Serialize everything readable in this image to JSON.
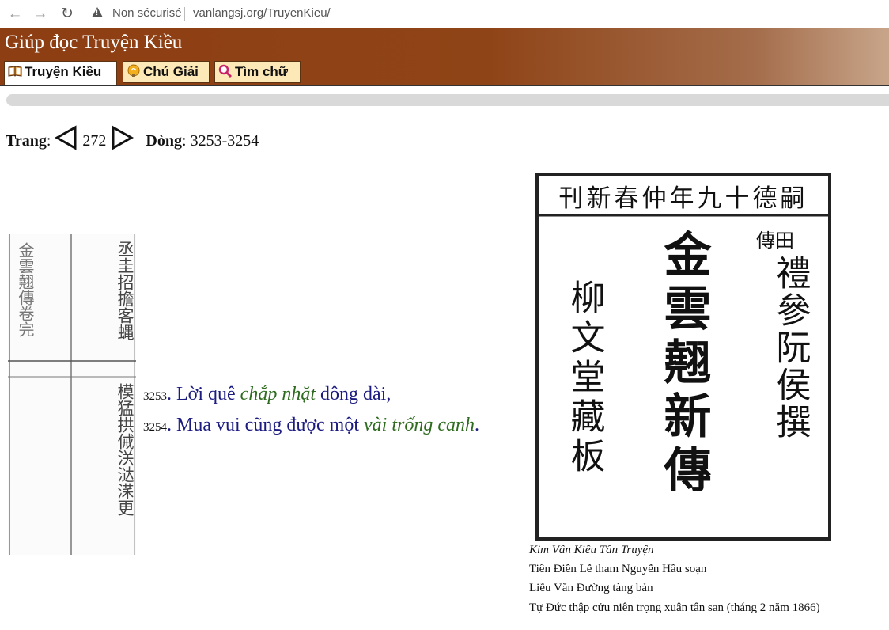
{
  "browser": {
    "security_label": "Non sécurisé",
    "url": "vanlangsj.org/TruyenKieu/"
  },
  "site": {
    "title": "Giúp đọc Truyện Kiều",
    "tabs": [
      {
        "label": "Truyện Kiều",
        "icon": "book-icon",
        "active": true
      },
      {
        "label": "Chú Giải",
        "icon": "lightbulb-icon",
        "active": false
      },
      {
        "label": "Tìm chữ",
        "icon": "magnifier-icon",
        "active": false
      }
    ],
    "colors": {
      "header_brown": "#8d3e12",
      "tab_bg": "#fde8b7",
      "verse_blue": "#1c1c80",
      "verse_green": "#2e6b1f"
    }
  },
  "pager": {
    "page_label": "Trang",
    "page_number": "272",
    "line_label": "Dòng",
    "line_range": "3253-3254"
  },
  "verses": [
    {
      "num": "3253",
      "before": "Lời quê ",
      "italic": "chắp nhặt",
      "after": " dông dài,"
    },
    {
      "num": "3254",
      "before": "Mua vui cũng được một ",
      "italic": "vài trống canh",
      "after": "."
    }
  ],
  "cover": {
    "header_text": "刊新春仲年九十德嗣",
    "center_column": "金雲翹新傳",
    "right_small": "傳田",
    "right_column": "禮參阮侯撰",
    "left_column": "柳文堂藏板"
  },
  "manuscript": {
    "col1": "金雲翹傳卷完",
    "col2": "丞圭招擔客蝿",
    "col3": "模猛拱㑘浂㳠㴕更"
  },
  "caption": {
    "title": "Kim Vân Kiều Tân Truyện",
    "line2": "Tiên Điền Lễ tham Nguyễn Hầu soạn",
    "line3": "Liễu Văn Đường tàng bản",
    "line4": "Tự Đức thập cửu niên trọng xuân tân san (tháng 2 năm 1866)"
  }
}
